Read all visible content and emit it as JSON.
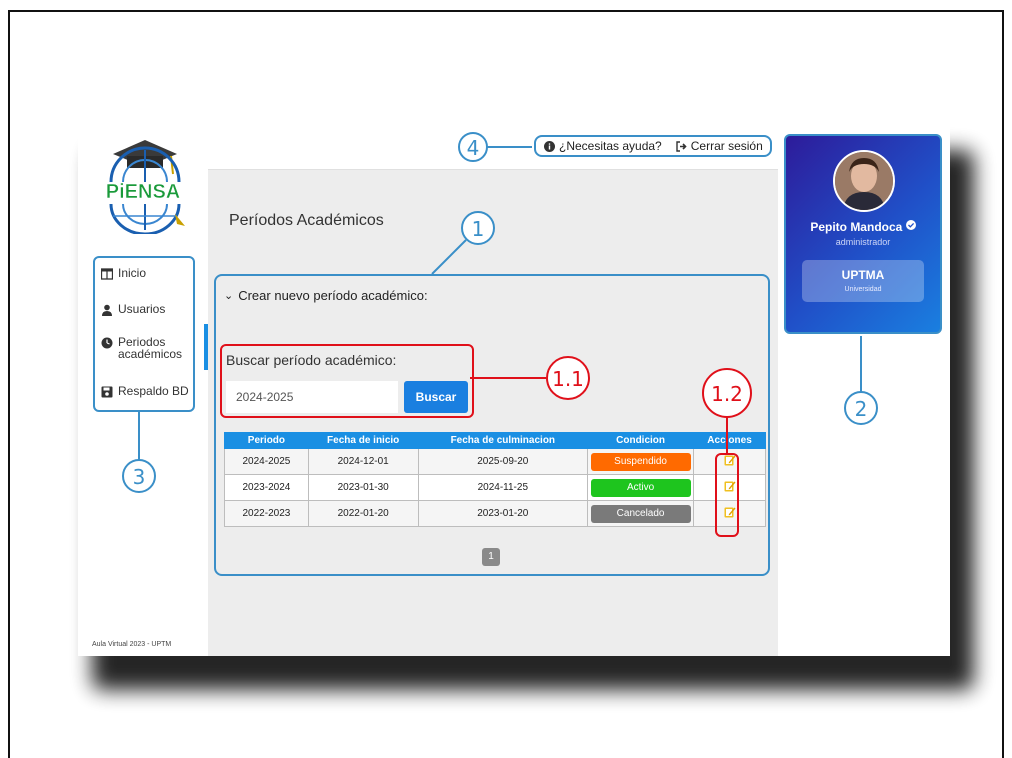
{
  "app": {
    "logo_text": "PiENSA",
    "footer": "Aula Virtual 2023 - UPTM"
  },
  "sidebar": {
    "items": [
      {
        "label": "Inicio",
        "icon": "columns-icon"
      },
      {
        "label": "Usuarios",
        "icon": "user-icon"
      },
      {
        "label_line1": "Periodos",
        "label_line2": "académicos",
        "icon": "clock-icon",
        "active": true
      },
      {
        "label": "Respaldo BD",
        "icon": "save-icon"
      }
    ]
  },
  "topbar": {
    "help_label": "¿Necesitas ayuda?",
    "logout_label": "Cerrar sesión"
  },
  "main": {
    "title": "Períodos Académicos",
    "collapse_label": "Crear nuevo período académico:",
    "search": {
      "label": "Buscar período académico:",
      "value": "2024-2025",
      "button_label": "Buscar"
    },
    "table": {
      "headers": [
        "Periodo",
        "Fecha de inicio",
        "Fecha de culminacion",
        "Condicion",
        "Acciones"
      ],
      "rows": [
        {
          "periodo": "2024-2025",
          "inicio": "2024-12-01",
          "fin": "2025-09-20",
          "condicion": "Suspendido",
          "color": "#ff6a00"
        },
        {
          "periodo": "2023-2024",
          "inicio": "2023-01-30",
          "fin": "2024-11-25",
          "condicion": "Activo",
          "color": "#1ec51e"
        },
        {
          "periodo": "2022-2023",
          "inicio": "2022-01-20",
          "fin": "2023-01-20",
          "condicion": "Cancelado",
          "color": "#7a7a7a"
        }
      ]
    },
    "pagination": {
      "current_page": "1"
    }
  },
  "profile": {
    "name": "Pepito Mandoca",
    "role": "administrador",
    "university": "UPTMA",
    "university_sub": "Universidad"
  },
  "annotations": {
    "one": "1",
    "one_one": "1.1",
    "one_two": "1.2",
    "two": "2",
    "three": "3",
    "four": "4"
  },
  "colors": {
    "accent": "#1a8fe3",
    "callout_blue": "#3a8fc8",
    "callout_red": "#e0101a"
  }
}
